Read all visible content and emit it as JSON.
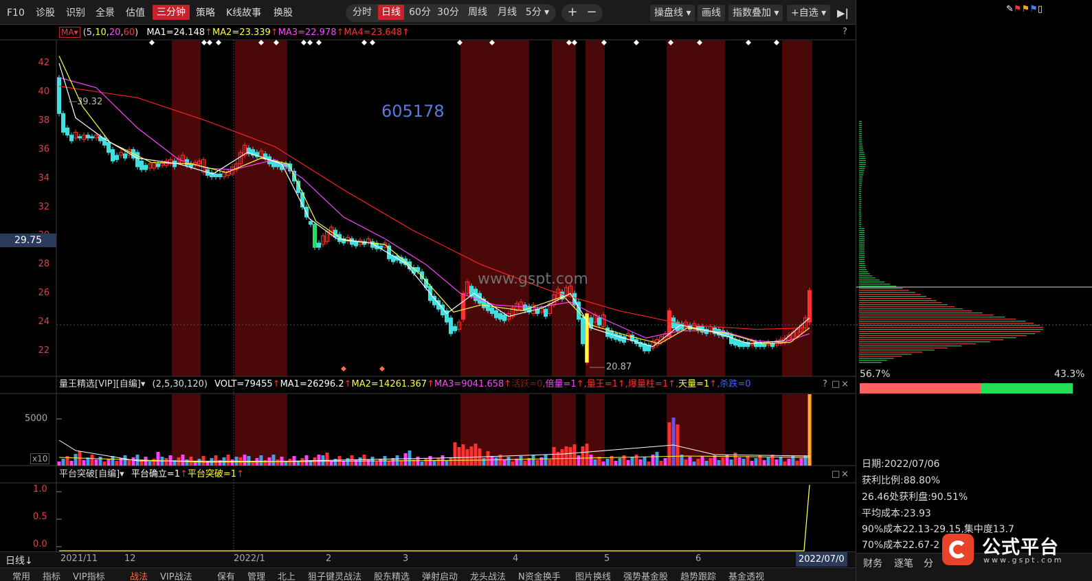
{
  "toolbar": {
    "items": [
      "F10",
      "诊股",
      "识别",
      "全景",
      "估值",
      "三分钟",
      "策略",
      "K线故事",
      "换股"
    ],
    "active_index": 5,
    "periods": [
      "分时",
      "日线",
      "60分",
      "30分",
      "周线",
      "月线",
      "5分"
    ],
    "active_period": 1,
    "plus": "+",
    "minus": "−",
    "right_buttons": [
      "操盘线",
      "画线",
      "指数叠加",
      "+自选"
    ],
    "collapse_icon": "double-chevron-right-icon"
  },
  "main_chart": {
    "indicator_name": "MA",
    "params_prefix": "(5,",
    "params": [
      "10",
      "20",
      "60"
    ],
    "params_suffix": ")",
    "ma1": "MA1=24.148",
    "ma2": "MA2=23.339",
    "ma3": "MA3=22.978",
    "ma4": "MA4=23.648",
    "arrow": "↑",
    "help": "?",
    "stock_code": "605178",
    "watermark": "www.gspt.com",
    "price_cursor": "29.75",
    "high_label": "39.32",
    "low_label": "20.87",
    "y_ticks": [
      "42",
      "40",
      "38",
      "36",
      "34",
      "32",
      "30",
      "28",
      "26",
      "24",
      "22"
    ]
  },
  "volume_panel": {
    "name": "量王精选[VIP][自编]",
    "params": "(2,5,30,120)",
    "volt": "VOLT=79455",
    "ma1": "MA1=26296.2",
    "ma2": "MA2=14261.367",
    "ma3": "MA3=9041.658",
    "items": [
      {
        "text": "活跃=0",
        "color": "#8a1a1a"
      },
      {
        "text": "倍量=1",
        "color": "#ff44ff"
      },
      {
        "text": "量王=1",
        "color": "#ff3030"
      },
      {
        "text": "爆量柱=1",
        "color": "#ff3030"
      },
      {
        "text": "天量=1",
        "color": "#ffff40"
      },
      {
        "text": "杀跌=0",
        "color": "#4060ff"
      }
    ],
    "arrow": "↑",
    "y_tick": "5000",
    "unit": "x10",
    "controls": [
      "?",
      "□",
      "×"
    ]
  },
  "platform_panel": {
    "name": "平台突破[自编]",
    "confirm": "平台确立=1",
    "breakout": "平台突破=1",
    "arrow": "↑",
    "y_ticks": [
      "1.0",
      "0.5",
      "0.0"
    ],
    "controls": [
      "□",
      "×"
    ]
  },
  "x_axis": {
    "period_label": "日线",
    "labels": [
      "2021/11",
      "12",
      "2022/1",
      "2",
      "3",
      "4",
      "5",
      "6"
    ],
    "last_date": "2022/07/0"
  },
  "chip_panel": {
    "left_pct": "56.7%",
    "right_pct": "43.3%",
    "profit_ratio": 0.567,
    "date": "日期:2022/07/06",
    "profit_ratio_text": "获利比例:88.80%",
    "profit_at": "26.46处获利盘:90.51%",
    "avg_cost": "平均成本:23.93",
    "cost90": "90%成本22.13-29.15,集中度13.7",
    "cost70": "70%成本22.67-2",
    "tabs": [
      "财务",
      "逐笔",
      "分"
    ]
  },
  "logo": {
    "name": "公式平台",
    "url": "www.gspt.com"
  },
  "bottom_tabs": [
    "常用",
    "指标",
    "VIP指标",
    "战法",
    "VIP战法",
    "保有",
    "管理",
    "北上",
    "狙子键灵战法",
    "股东精选",
    "弹射启动",
    "龙头战法",
    "N资金换手",
    "图片换线",
    "强势基金股",
    "趋势跟踪",
    "基金透视"
  ],
  "bottom_active": 3,
  "colors": {
    "up": "#ff3030",
    "down": "#40e0e0",
    "ma5": "#ffffff",
    "ma10": "#ffff40",
    "ma20": "#ff44ff",
    "ma60": "#ff2020",
    "accent": "#c8232c",
    "highlight_band": "#5a0c0c"
  }
}
